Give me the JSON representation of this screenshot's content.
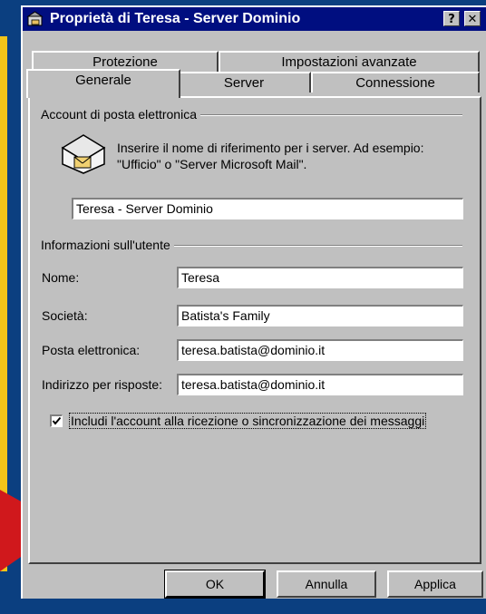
{
  "window": {
    "title": "Proprietà di Teresa - Server Dominio",
    "help_label": "?",
    "close_label": "✕"
  },
  "tabs": {
    "row_back": [
      "Protezione",
      "Impostazioni avanzate"
    ],
    "row_front": [
      "Generale",
      "Server",
      "Connessione"
    ],
    "active": "Generale"
  },
  "mail_account": {
    "section_label": "Account di posta elettronica",
    "description_line1": "Inserire il nome di riferimento per i server. Ad esempio:",
    "description_line2": "\"Ufficio\" o \"Server Microsoft Mail\".",
    "account_name": "Teresa - Server Dominio"
  },
  "user_info": {
    "section_label": "Informazioni sull'utente",
    "name_label": "Nome:",
    "name_value": "Teresa",
    "company_label": "Società:",
    "company_value": "Batista's Family",
    "email_label": "Posta elettronica:",
    "email_value": "teresa.batista@dominio.it",
    "reply_label": "Indirizzo per risposte:",
    "reply_value": "teresa.batista@dominio.it"
  },
  "include_account": {
    "label": "Includi l'account alla ricezione o sincronizzazione dei messaggi",
    "checked": true
  },
  "buttons": {
    "ok": "OK",
    "cancel": "Annulla",
    "apply": "Applica"
  },
  "colors": {
    "desktop": "#0b3f80",
    "titlebar": "#000e80",
    "dialog": "#c0c0c0",
    "accent_yellow": "#f2c418",
    "accent_red": "#d0181c"
  }
}
